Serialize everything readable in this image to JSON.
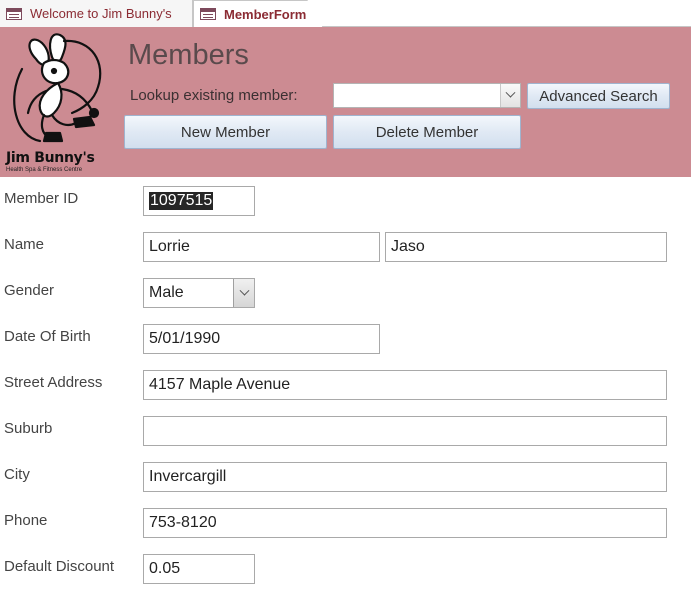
{
  "tabs": [
    {
      "label": "Welcome to Jim Bunny's",
      "active": false
    },
    {
      "label": "MemberForm",
      "active": true
    }
  ],
  "header": {
    "title": "Members",
    "lookup_label": "Lookup existing member:",
    "lookup_value": "",
    "advanced_search_label": "Advanced Search",
    "new_member_label": "New Member",
    "delete_member_label": "Delete Member",
    "background_color": "#cc8b92"
  },
  "logo": {
    "name": "Jim Bunny's",
    "tagline": "Health Spa & Fitness Centre"
  },
  "form": {
    "member_id": {
      "label": "Member ID",
      "value": "1097515"
    },
    "name": {
      "label": "Name",
      "first": "Lorrie",
      "last": "Jaso"
    },
    "gender": {
      "label": "Gender",
      "value": "Male"
    },
    "dob": {
      "label": "Date Of Birth",
      "value": "5/01/1990"
    },
    "street": {
      "label": "Street Address",
      "value": "4157 Maple Avenue"
    },
    "suburb": {
      "label": "Suburb",
      "value": ""
    },
    "city": {
      "label": "City",
      "value": "Invercargill"
    },
    "phone": {
      "label": "Phone",
      "value": "753-8120"
    },
    "discount": {
      "label": "Default Discount",
      "value": "0.05"
    }
  }
}
